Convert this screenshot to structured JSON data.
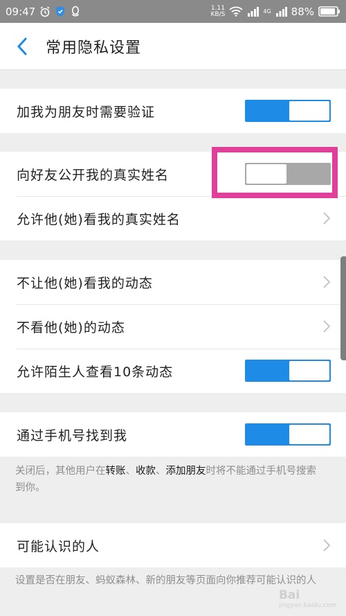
{
  "statusbar": {
    "time": "09:47",
    "net_speed_value": "1.11",
    "net_speed_unit": "KB/S",
    "network_type": "4G",
    "battery": "88%"
  },
  "header": {
    "title": "常用隐私设置"
  },
  "group1": {
    "verify": {
      "label": "加我为朋友时需要验证",
      "on": true
    }
  },
  "group2": {
    "show_real_name": {
      "label": "向好友公开我的真实姓名",
      "on": false
    },
    "allow_see_name": {
      "label": "允许他(她)看我的真实姓名"
    }
  },
  "group3": {
    "hide_moments": {
      "label": "不让他(她)看我的动态"
    },
    "not_see_moments": {
      "label": "不看他(她)的动态"
    },
    "stranger_ten": {
      "label": "允许陌生人查看10条动态",
      "on": true
    }
  },
  "group4": {
    "find_by_phone": {
      "label": "通过手机号找到我",
      "on": true
    },
    "desc": {
      "p1": "关闭后，其他用户在",
      "k1": "转账",
      "s1": "、",
      "k2": "收款",
      "s2": "、",
      "k3": "添加朋友",
      "p2": "时将不能通过手机号搜索到你。"
    }
  },
  "group5": {
    "may_know": {
      "label": "可能认识的人"
    },
    "desc": "设置是否在朋友、蚂蚁森林、新的朋友等页面向你推荐可能认识的人"
  },
  "watermark": {
    "text": "Bai",
    "sub": "jingyan.baidu.com"
  }
}
